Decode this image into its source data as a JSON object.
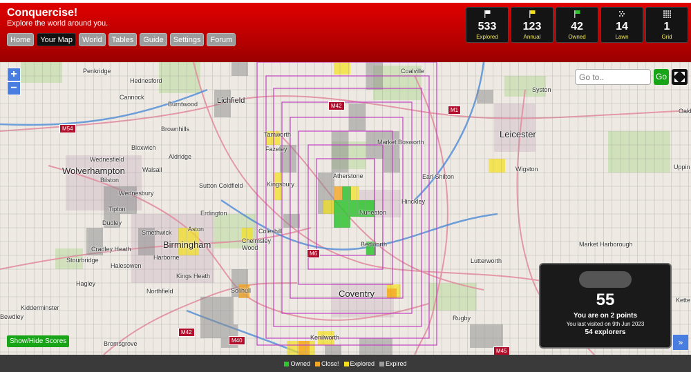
{
  "header": {
    "title": "Conquercise!",
    "subtitle": "Explore the world around you."
  },
  "nav": [
    {
      "label": "Home",
      "active": false
    },
    {
      "label": "Your Map",
      "active": true
    },
    {
      "label": "World",
      "active": false
    },
    {
      "label": "Tables",
      "active": false
    },
    {
      "label": "Guide",
      "active": false
    },
    {
      "label": "Settings",
      "active": false
    },
    {
      "label": "Forum",
      "active": false
    }
  ],
  "stats": [
    {
      "value": "533",
      "label": "Explored",
      "icon": "flag-white-icon",
      "color": "#ffffff"
    },
    {
      "value": "123",
      "label": "Annual",
      "icon": "flag-yellow-icon",
      "color": "#f5e11b"
    },
    {
      "value": "42",
      "label": "Owned",
      "icon": "flag-green-icon",
      "color": "#31c431"
    },
    {
      "value": "14",
      "label": "Lawn",
      "icon": "lawn-icon",
      "color": "#cccccc"
    },
    {
      "value": "1",
      "label": "Grid",
      "icon": "grid-icon",
      "color": "#cccccc"
    }
  ],
  "map": {
    "zoom_in": "+",
    "zoom_out": "−",
    "goto_placeholder": "Go to..",
    "go_label": "Go",
    "show_hide_label": "Show/Hide Scores",
    "expand_label": "»",
    "labels": [
      "Penkridge",
      "Hednesford",
      "Cannock",
      "Burntwood",
      "Lichfield",
      "Brownhills",
      "Bloxwich",
      "Aldridge",
      "Wednesfield",
      "Wolverhampton",
      "Walsall",
      "Bilston",
      "Wednesbury",
      "Tipton",
      "Dudley",
      "Smethwick",
      "Cradley Heath",
      "Stourbridge",
      "Halesowen",
      "Hagley",
      "Kidderminster",
      "Bewdley",
      "Bromsgrove",
      "Birmingham",
      "Harborne",
      "Kings Heath",
      "Northfield",
      "Solihull",
      "Sutton Coldfield",
      "Erdington",
      "Aston",
      "Coleshill",
      "Chelmsley Wood",
      "Tamworth",
      "Fazeley",
      "Kingsbury",
      "Atherstone",
      "Nuneaton",
      "Bedworth",
      "Coventry",
      "Kenilworth",
      "Coalville",
      "Market Bosworth",
      "Earl Shilton",
      "Hinckley",
      "Leicester",
      "Wigston",
      "Syston",
      "Lutterworth",
      "Market Harborough",
      "Rugby",
      "Oakh",
      "Uppin",
      "Kette"
    ],
    "roads": [
      "M54",
      "M42",
      "M1",
      "M6",
      "M42",
      "M40",
      "M45"
    ]
  },
  "scores": {
    "score": "55",
    "points_text": "You are on 2 points",
    "visited_text": "You last visited on 9th Jun 2023",
    "explorers_text": "54 explorers"
  },
  "legend": [
    {
      "label": "Owned",
      "color": "#31c431"
    },
    {
      "label": "Close!",
      "color": "#f5a623"
    },
    {
      "label": "Explored",
      "color": "#f5e11b"
    },
    {
      "label": "Expired",
      "color": "#9a9a9a"
    }
  ]
}
